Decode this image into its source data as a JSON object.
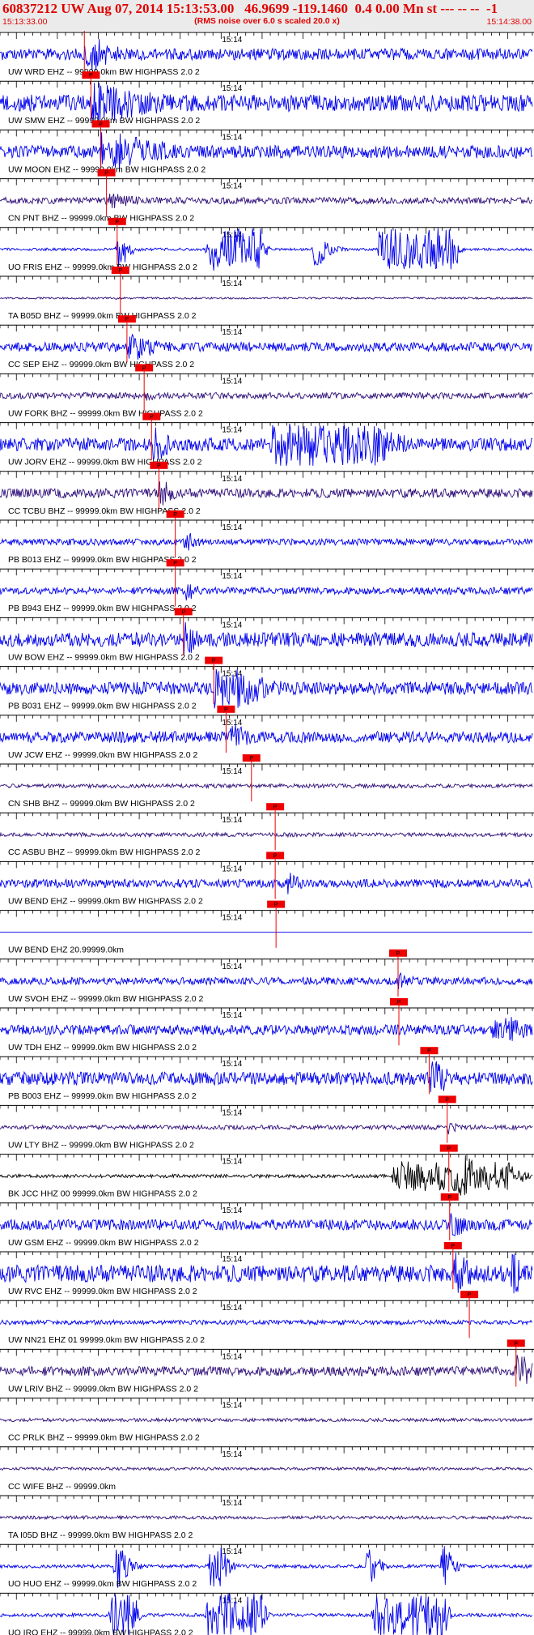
{
  "header": {
    "title": "60837212 UW Aug 07, 2014 15:13:53.00   46.9699 -119.1460  0.4 0.00 Mn st --- -- --  -1",
    "subtitle": "(RMS noise over 6.0 s scaled 20.0 x)",
    "start_time": "15:13:33.00",
    "end_time": "15:14:38.00"
  },
  "colors": {
    "header_text": "#e00000",
    "header_bg": "#ebebeb",
    "trace_blue": "#0000ee",
    "trace_purple": "#30107a",
    "trace_black": "#000000",
    "pick_red": "#ee0000"
  },
  "chart_data": {
    "type": "line",
    "title": "60837212 UW Aug 07, 2014 15:13:53.00   46.9699 -119.1460  0.4 0.00 Mn st --- -- --  -1",
    "subtitle": "(RMS noise over 6.0 s scaled 20.0 x)",
    "x_range": [
      "15:13:33.00",
      "15:14:38.00"
    ],
    "x_range_seconds": [
      0,
      65
    ],
    "minute_tick_label": "15:14",
    "minute_tick_seconds": 27,
    "grid": false,
    "pick_label": "P",
    "traces": [
      {
        "label": "UW WRD EHZ -- 99999.0km BW  HIGHPASS  2.0  2",
        "color": "blue",
        "amp": 0.75,
        "noise": 0.35,
        "pick": 10.3,
        "events": [
          [
            10.3,
            1.0,
            1.6,
            3.5
          ]
        ]
      },
      {
        "label": "UW SMW EHZ -- 99999.0km BW  HIGHPASS  2.0  2",
        "color": "blue",
        "amp": 0.95,
        "noise": 0.4,
        "pick": 11.1,
        "events": [
          [
            11.1,
            1.0,
            2.0,
            9.0
          ]
        ]
      },
      {
        "label": "UW MOON EHZ -- 99999.0km BW  HIGHPASS  2.0  2",
        "color": "blue",
        "amp": 0.9,
        "noise": 0.32,
        "pick": 12.3,
        "events": [
          [
            12.3,
            1.0,
            2.0,
            8.0
          ]
        ]
      },
      {
        "label": "CN PNT BHZ -- 99999.0km BW  HIGHPASS  2.0  2",
        "color": "purple",
        "amp": 0.5,
        "noise": 0.3,
        "pick": 13.0,
        "events": [
          [
            13.0,
            0.7,
            1.0,
            4.0
          ]
        ]
      },
      {
        "label": "UO FRIS EHZ -- 99999.0km BW  HIGHPASS  2.0  2",
        "color": "blue",
        "amp": 0.98,
        "noise": 0.06,
        "pick": 14.3,
        "events": [
          [
            14.3,
            1.0,
            0.6,
            1.0
          ],
          [
            25.3,
            1.0,
            6.8,
            0.4
          ],
          [
            38.3,
            0.8,
            0.6,
            1.4
          ],
          [
            46.2,
            1.0,
            9.5,
            0.4
          ]
        ]
      },
      {
        "label": "TA B05D BHZ -- 99999.0km BW  HIGHPASS  2.0  2",
        "color": "purple",
        "amp": 0.35,
        "noise": 0.12,
        "pick": 14.7,
        "events": []
      },
      {
        "label": "CC SEP EHZ -- 99999.0km BW  HIGHPASS  2.0  2",
        "color": "blue",
        "amp": 0.7,
        "noise": 0.3,
        "pick": 15.5,
        "events": [
          [
            15.5,
            0.9,
            1.0,
            4.0
          ]
        ]
      },
      {
        "label": "UW FORK BHZ -- 99999.0km BW  HIGHPASS  2.0  2",
        "color": "purple",
        "amp": 0.4,
        "noise": 0.35,
        "pick": 17.6,
        "events": [
          [
            17.6,
            0.6,
            0.5,
            2.0
          ]
        ]
      },
      {
        "label": "UW JORV EHZ -- 99999.0km BW  HIGHPASS  2.0  2",
        "color": "blue",
        "amp": 0.98,
        "noise": 0.3,
        "pick": 18.5,
        "events": [
          [
            18.5,
            0.8,
            0.8,
            2.0
          ],
          [
            33.0,
            1.0,
            13.0,
            4.0
          ]
        ]
      },
      {
        "label": "CC TCBU BHZ -- 99999.0km BW  HIGHPASS  2.0  2",
        "color": "purple",
        "amp": 0.7,
        "noise": 0.3,
        "pick": 19.4,
        "events": [
          [
            19.4,
            0.9,
            0.6,
            1.5
          ]
        ]
      },
      {
        "label": "PB B013 EHZ -- 99999.0km BW  HIGHPASS  2.0  2",
        "color": "blue",
        "amp": 0.5,
        "noise": 0.3,
        "pick": 21.4,
        "events": [
          [
            22.5,
            0.9,
            0.6,
            1.5
          ]
        ]
      },
      {
        "label": "PB B943 EHZ -- 99999.0km BW  HIGHPASS  2.0  2",
        "color": "blue",
        "amp": 0.5,
        "noise": 0.32,
        "pick": 21.4,
        "events": [
          [
            22.6,
            0.9,
            0.6,
            1.5
          ]
        ]
      },
      {
        "label": "UW BOW EHZ -- 99999.0km BW  HIGHPASS  2.0  2",
        "color": "blue",
        "amp": 0.8,
        "noise": 0.4,
        "pick": 22.4,
        "events": [
          [
            22.4,
            1.0,
            0.6,
            1.5
          ]
        ]
      },
      {
        "label": "PB B031 EHZ -- 99999.0km BW  HIGHPASS  2.0  2",
        "color": "blue",
        "amp": 0.95,
        "noise": 0.3,
        "pick": 26.1,
        "events": [
          [
            26.1,
            1.0,
            3.0,
            5.0
          ]
        ]
      },
      {
        "label": "UW JCW EHZ -- 99999.0km BW  HIGHPASS  2.0  2",
        "color": "blue",
        "amp": 0.65,
        "noise": 0.4,
        "pick": 27.6,
        "events": [
          [
            27.6,
            0.9,
            1.0,
            4.0
          ]
        ]
      },
      {
        "label": "CN SHB BHZ -- 99999.0km BW  HIGHPASS  2.0  2",
        "color": "purple",
        "amp": 0.3,
        "noise": 0.3,
        "pick": 30.7,
        "events": []
      },
      {
        "label": "CC ASBU BHZ -- 99999.0km BW  HIGHPASS  2.0  2",
        "color": "purple",
        "amp": 0.3,
        "noise": 0.3,
        "pick": 33.6,
        "events": [
          [
            35.0,
            0.5,
            0.5,
            1.0
          ]
        ]
      },
      {
        "label": "UW BEND EHZ -- 99999.0km BW  HIGHPASS  2.0  2",
        "color": "blue",
        "amp": 0.55,
        "noise": 0.35,
        "pick": 33.6,
        "events": [
          [
            35.0,
            0.9,
            0.7,
            1.5
          ]
        ]
      },
      {
        "label": "UW BEND EHZ 20.99999.0km",
        "color": "blue",
        "amp": 0.0,
        "noise": 0.0,
        "pick": 33.7,
        "events": []
      },
      {
        "label": "UW SVOH EHZ -- 99999.0km BW  HIGHPASS  2.0  2",
        "color": "blue",
        "amp": 0.55,
        "noise": 0.3,
        "pick": 48.6,
        "events": [
          [
            48.6,
            0.8,
            0.6,
            1.5
          ]
        ]
      },
      {
        "label": "UW TDH EHZ -- 99999.0km BW  HIGHPASS  2.0  2",
        "color": "blue",
        "amp": 0.65,
        "noise": 0.35,
        "pick": 48.7,
        "events": [
          [
            60.0,
            0.9,
            2.5,
            4.0
          ]
        ]
      },
      {
        "label": "PB B003 EHZ -- 99999.0km BW  HIGHPASS  2.0  2",
        "color": "blue",
        "amp": 0.85,
        "noise": 0.35,
        "pick": 52.4,
        "events": [
          [
            52.4,
            1.0,
            0.8,
            3.0
          ]
        ]
      },
      {
        "label": "UW LTY BHZ -- 99999.0km BW  HIGHPASS  2.0  2",
        "color": "purple",
        "amp": 0.5,
        "noise": 0.2,
        "pick": 54.6,
        "events": [
          [
            54.6,
            0.9,
            0.4,
            1.0
          ]
        ]
      },
      {
        "label": "BK JCC HHZ 00 99999.0km BW  HIGHPASS  2.0  2",
        "color": "black",
        "amp": 0.98,
        "noise": 0.08,
        "pick": 54.8,
        "events": [
          [
            48.0,
            0.7,
            14.0,
            2.0
          ],
          [
            56.0,
            1.0,
            1.0,
            3.0
          ]
        ]
      },
      {
        "label": "UW GSM EHZ -- 99999.0km BW  HIGHPASS  2.0  2",
        "color": "blue",
        "amp": 0.6,
        "noise": 0.4,
        "pick": 54.9,
        "events": [
          [
            55.0,
            0.9,
            0.8,
            2.0
          ]
        ]
      },
      {
        "label": "UW RVC EHZ -- 99999.0km BW  HIGHPASS  2.0  2",
        "color": "blue",
        "amp": 0.98,
        "noise": 0.4,
        "pick": 55.3,
        "events": [
          [
            55.3,
            1.0,
            1.0,
            2.0
          ],
          [
            62.4,
            1.0,
            0.6,
            1.5
          ]
        ]
      },
      {
        "label": "UW NN21 EHZ 01 99999.0km BW  HIGHPASS  2.0  2",
        "color": "blue",
        "amp": 0.35,
        "noise": 0.3,
        "pick": 57.3,
        "events": []
      },
      {
        "label": "UW LRIV BHZ -- 99999.0km BW  HIGHPASS  2.0  2",
        "color": "purple",
        "amp": 0.85,
        "noise": 0.25,
        "pick": 63.0,
        "events": [
          [
            63.0,
            1.0,
            0.6,
            2.0
          ]
        ]
      },
      {
        "label": "CC PRLK BHZ -- 99999.0km BW  HIGHPASS  2.0  2",
        "color": "purple",
        "amp": 0.25,
        "noise": 0.3,
        "pick": null,
        "events": []
      },
      {
        "label": "CC WIFE BHZ -- 99999.0km",
        "color": "purple",
        "amp": 0.22,
        "noise": 0.3,
        "pick": null,
        "events": []
      },
      {
        "label": "TA I05D BHZ -- 99999.0km BW  HIGHPASS  2.0  2",
        "color": "purple",
        "amp": 0.25,
        "noise": 0.3,
        "pick": null,
        "events": []
      },
      {
        "label": "UO HUO EHZ -- 99999.0km BW  HIGHPASS  2.0  2",
        "color": "blue",
        "amp": 0.98,
        "noise": 0.08,
        "pick": null,
        "events": [
          [
            14.0,
            1.0,
            0.7,
            1.2
          ],
          [
            25.6,
            1.0,
            1.4,
            1.0
          ],
          [
            44.8,
            1.0,
            0.6,
            1.0
          ],
          [
            53.8,
            1.0,
            0.8,
            1.0
          ]
        ]
      },
      {
        "label": "UO IRO EHZ -- 99999.0km BW  HIGHPASS  2.0  2",
        "color": "blue",
        "amp": 0.98,
        "noise": 0.08,
        "pick": null,
        "events": [
          [
            13.5,
            1.0,
            3.0,
            0.4
          ],
          [
            25.3,
            1.0,
            6.8,
            0.4
          ],
          [
            45.5,
            1.0,
            9.0,
            0.4
          ]
        ]
      }
    ]
  }
}
